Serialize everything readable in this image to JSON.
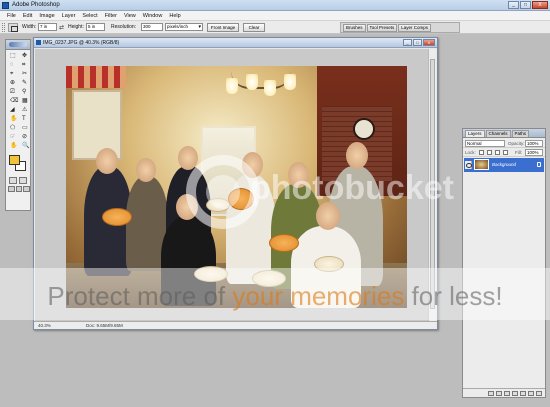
{
  "app": {
    "title": "Adobe Photoshop"
  },
  "window_controls": {
    "minimize": "_",
    "maximize": "□",
    "close": "X"
  },
  "menu": [
    "File",
    "Edit",
    "Image",
    "Layer",
    "Select",
    "Filter",
    "View",
    "Window",
    "Help"
  ],
  "options_bar": {
    "width_label": "Width:",
    "width_value": "7 in",
    "swap_icon": "⇄",
    "height_label": "Height:",
    "height_value": "5 in",
    "resolution_label": "Resolution:",
    "resolution_value": "300",
    "resolution_unit": "pixels/inch",
    "front_image_button": "Front Image",
    "clear_button": "Clear"
  },
  "palette_well": [
    "Brushes",
    "Tool Presets",
    "Layer Comps"
  ],
  "toolbox": {
    "tools": [
      "⬚",
      "✥",
      "◌",
      "⌗",
      "⌖",
      "✂",
      "⊕",
      "✎",
      "⎚",
      "⚲",
      "⌫",
      "▦",
      "◢",
      "⚠",
      "✋",
      "T",
      "⬠",
      "▭",
      "☞",
      "⊘",
      "🔍",
      "✋"
    ]
  },
  "document": {
    "title": "IMG_0237.JPG @ 40.3% (RGB/8)",
    "zoom": "40.3%",
    "doc_size": "Doc: 9.65M/9.65M"
  },
  "layers_panel": {
    "tabs": [
      "Layers",
      "Channels",
      "Paths"
    ],
    "blend_mode": "Normal",
    "opacity_label": "Opacity:",
    "opacity_value": "100%",
    "lock_label": "Lock:",
    "fill_label": "Fill:",
    "fill_value": "100%",
    "layers": [
      {
        "name": "Background",
        "visible": true,
        "locked": true
      }
    ]
  },
  "watermark": {
    "brand": "photobucket",
    "tagline_part1": "Protect more of ",
    "tagline_highlight": "your memories",
    "tagline_part2": " for less!"
  },
  "colors": {
    "foreground": "#f2c23a",
    "background": "#ffffff",
    "layer_selection": "#3a6fd0"
  }
}
